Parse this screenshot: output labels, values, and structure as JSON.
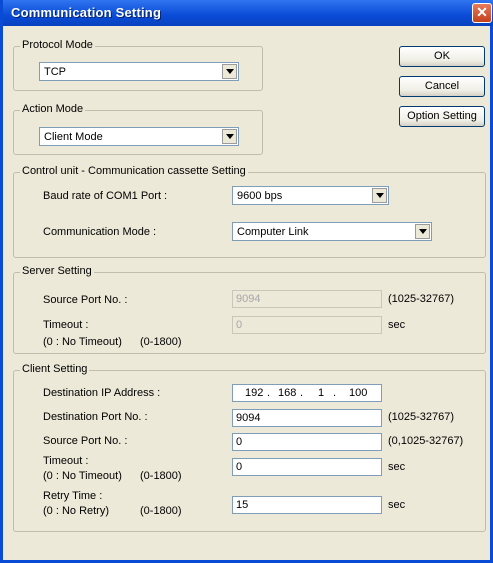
{
  "window": {
    "title": "Communication Setting",
    "close_symbol": "✕"
  },
  "buttons": {
    "ok": "OK",
    "cancel": "Cancel",
    "option": "Option Setting"
  },
  "protocol": {
    "group_label": "Protocol Mode",
    "value": "TCP"
  },
  "action": {
    "group_label": "Action Mode",
    "value": "Client Mode"
  },
  "control": {
    "group_label": "Control unit - Communication cassette Setting",
    "baud_label": "Baud rate of COM1 Port :",
    "baud_value": "9600 bps",
    "comm_label": "Communication Mode :",
    "comm_value": "Computer Link"
  },
  "server": {
    "group_label": "Server Setting",
    "source_port_label": "Source Port No. :",
    "source_port_value": "9094",
    "source_port_range": "(1025-32767)",
    "timeout_label": "Timeout  :",
    "timeout_note": "(0 : No Timeout)",
    "timeout_range": "(0-1800)",
    "timeout_value": "0",
    "timeout_unit": "sec"
  },
  "client": {
    "group_label": "Client Setting",
    "dest_ip_label": "Destination IP Address :",
    "dest_ip": [
      "192",
      "168",
      "1",
      "100"
    ],
    "dest_port_label": "Destination Port No. :",
    "dest_port_value": "9094",
    "dest_port_range": "(1025-32767)",
    "source_port_label": "Source Port No. :",
    "source_port_value": "0",
    "source_port_range": "(0,1025-32767)",
    "timeout_label": "Timeout :",
    "timeout_note": "(0 : No Timeout)",
    "timeout_range": "(0-1800)",
    "timeout_value": "0",
    "timeout_unit": "sec",
    "retry_label": "Retry Time :",
    "retry_note": "(0 : No Retry)",
    "retry_range": "(0-1800)",
    "retry_value": "15",
    "retry_unit": "sec"
  }
}
